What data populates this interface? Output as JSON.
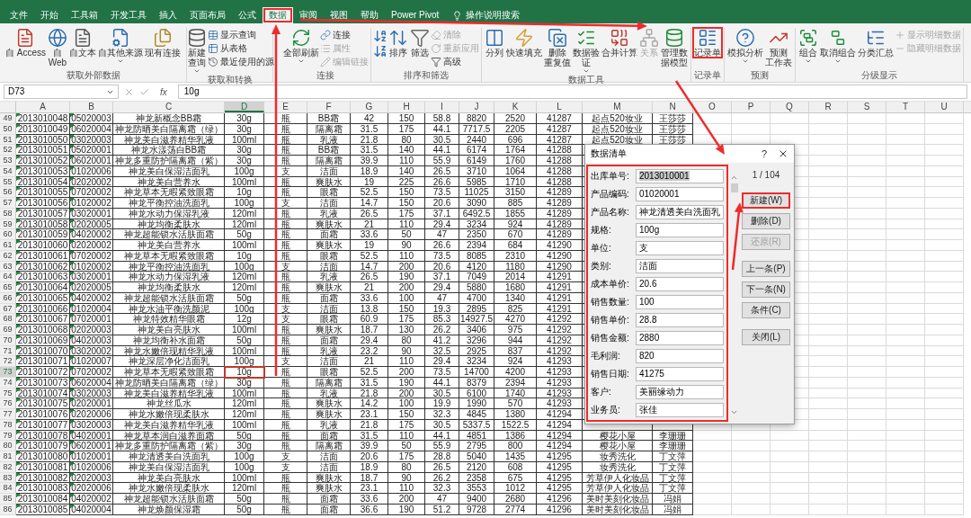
{
  "tabs": [
    {
      "label": "文件",
      "selected": false,
      "annotated": false
    },
    {
      "label": "开始",
      "selected": false,
      "annotated": false
    },
    {
      "label": "工具箱",
      "selected": false,
      "annotated": false
    },
    {
      "label": "开发工具",
      "selected": false,
      "annotated": false
    },
    {
      "label": "插入",
      "selected": false,
      "annotated": false
    },
    {
      "label": "页面布局",
      "selected": false,
      "annotated": false
    },
    {
      "label": "公式",
      "selected": false,
      "annotated": false
    },
    {
      "label": "数据",
      "selected": true,
      "annotated": true
    },
    {
      "label": "审阅",
      "selected": false,
      "annotated": false
    },
    {
      "label": "视图",
      "selected": false,
      "annotated": false
    },
    {
      "label": "帮助",
      "selected": false,
      "annotated": false
    },
    {
      "label": "Power Pivot",
      "selected": false,
      "annotated": false
    }
  ],
  "tell_me": "操作说明搜索",
  "ribbon": {
    "groups": [
      {
        "label": "获取外部数据",
        "items": [
          {
            "kind": "large",
            "lines": [
              "自 Access"
            ],
            "dropdown": false,
            "disabled": false,
            "annotated": false
          },
          {
            "kind": "large",
            "lines": [
              "自",
              "Web"
            ],
            "dropdown": false,
            "disabled": false,
            "annotated": false
          },
          {
            "kind": "large",
            "lines": [
              "自文本"
            ],
            "dropdown": false,
            "disabled": false,
            "annotated": false
          },
          {
            "kind": "large",
            "lines": [
              "自其他来源"
            ],
            "dropdown": true,
            "disabled": false,
            "annotated": false
          },
          {
            "kind": "large",
            "lines": [
              "现有连接"
            ],
            "dropdown": false,
            "disabled": false,
            "annotated": false
          }
        ]
      },
      {
        "label": "获取和转换",
        "items": [
          {
            "kind": "large",
            "lines": [
              "新建",
              "查询"
            ],
            "dropdown": true,
            "disabled": false,
            "annotated": false
          },
          {
            "kind": "stack",
            "items": [
              {
                "label": "显示查询",
                "disabled": false
              },
              {
                "label": "从表格",
                "disabled": false
              },
              {
                "label": "最近使用的源",
                "disabled": false
              }
            ]
          }
        ]
      },
      {
        "label": "连接",
        "items": [
          {
            "kind": "large",
            "lines": [
              "全部刷新"
            ],
            "dropdown": true,
            "disabled": false,
            "annotated": false
          },
          {
            "kind": "stack",
            "items": [
              {
                "label": "连接",
                "disabled": false
              },
              {
                "label": "属性",
                "disabled": true
              },
              {
                "label": "编辑链接",
                "disabled": true
              }
            ]
          }
        ]
      },
      {
        "label": "排序和筛选",
        "items": [
          {
            "kind": "sort-pair"
          },
          {
            "kind": "large",
            "lines": [
              "排序"
            ],
            "dropdown": false,
            "disabled": false,
            "annotated": false
          },
          {
            "kind": "large",
            "lines": [
              "筛选"
            ],
            "dropdown": false,
            "disabled": false,
            "annotated": false
          },
          {
            "kind": "stack",
            "items": [
              {
                "label": "清除",
                "disabled": true
              },
              {
                "label": "重新应用",
                "disabled": true
              },
              {
                "label": "高级",
                "disabled": false
              }
            ]
          }
        ]
      },
      {
        "label": "数据工具",
        "items": [
          {
            "kind": "large",
            "lines": [
              "分列"
            ],
            "dropdown": false,
            "disabled": false,
            "annotated": false
          },
          {
            "kind": "large",
            "lines": [
              "快速填充"
            ],
            "dropdown": false,
            "disabled": false,
            "annotated": false
          },
          {
            "kind": "large",
            "lines": [
              "删除",
              "重复值"
            ],
            "dropdown": false,
            "disabled": false,
            "annotated": false
          },
          {
            "kind": "large",
            "lines": [
              "数据验",
              "证"
            ],
            "dropdown": true,
            "disabled": false,
            "annotated": false
          },
          {
            "kind": "large",
            "lines": [
              "合并计算"
            ],
            "dropdown": false,
            "disabled": false,
            "annotated": false
          },
          {
            "kind": "large",
            "lines": [
              "关系"
            ],
            "dropdown": false,
            "disabled": true,
            "annotated": false
          },
          {
            "kind": "large",
            "lines": [
              "管理数",
              "据模型"
            ],
            "dropdown": false,
            "disabled": false,
            "annotated": false
          }
        ]
      },
      {
        "label": "记录单",
        "items": [
          {
            "kind": "large",
            "lines": [
              "记录单"
            ],
            "dropdown": false,
            "disabled": false,
            "annotated": true
          }
        ]
      },
      {
        "label": "预测",
        "items": [
          {
            "kind": "large",
            "lines": [
              "模拟分析"
            ],
            "dropdown": true,
            "disabled": false,
            "annotated": false
          },
          {
            "kind": "large",
            "lines": [
              "预测",
              "工作表"
            ],
            "dropdown": false,
            "disabled": false,
            "annotated": false
          }
        ]
      },
      {
        "label": "分级显示",
        "items": [
          {
            "kind": "large",
            "lines": [
              "组合"
            ],
            "dropdown": true,
            "disabled": false,
            "annotated": false
          },
          {
            "kind": "large",
            "lines": [
              "取消组合"
            ],
            "dropdown": true,
            "disabled": false,
            "annotated": false
          },
          {
            "kind": "large",
            "lines": [
              "分类汇总"
            ],
            "dropdown": false,
            "disabled": false,
            "annotated": false
          },
          {
            "kind": "stack",
            "items": [
              {
                "label": "显示明细数据",
                "disabled": true
              },
              {
                "label": "隐藏明细数据",
                "disabled": true
              }
            ]
          }
        ]
      }
    ]
  },
  "formula_bar": {
    "name_box": "D73",
    "fx": "fx",
    "value": "10g"
  },
  "sheet": {
    "columns": [
      {
        "label": "A",
        "selected": false,
        "flag": true
      },
      {
        "label": "B",
        "selected": false,
        "flag": true
      },
      {
        "label": "C",
        "selected": false,
        "flag": false
      },
      {
        "label": "D",
        "selected": true,
        "flag": false
      },
      {
        "label": "E",
        "selected": false,
        "flag": false
      },
      {
        "label": "F",
        "selected": false,
        "flag": false
      },
      {
        "label": "G",
        "selected": false,
        "flag": false
      },
      {
        "label": "H",
        "selected": false,
        "flag": false
      },
      {
        "label": "I",
        "selected": false,
        "flag": false
      },
      {
        "label": "J",
        "selected": false,
        "flag": false
      },
      {
        "label": "K",
        "selected": false,
        "flag": false
      },
      {
        "label": "L",
        "selected": false,
        "flag": false
      },
      {
        "label": "M",
        "selected": false,
        "flag": false
      },
      {
        "label": "N",
        "selected": false,
        "flag": false
      },
      {
        "label": "O",
        "selected": false,
        "flag": false
      },
      {
        "label": "P",
        "selected": false,
        "flag": false
      },
      {
        "label": "Q",
        "selected": false,
        "flag": false
      },
      {
        "label": "R",
        "selected": false,
        "flag": false
      },
      {
        "label": "S",
        "selected": false,
        "flag": false
      },
      {
        "label": "T",
        "selected": false,
        "flag": false
      },
      {
        "label": "U",
        "selected": false,
        "flag": false
      }
    ],
    "rows": [
      {
        "number": "49",
        "selected": false,
        "cells": [
          "2013010048",
          "05020003",
          "神龙新概念BB霜",
          "30g",
          "瓶",
          "BB霜",
          "42",
          "150",
          "58.8",
          "8820",
          "2520",
          "41287",
          "起点520妆业",
          "王莎莎"
        ]
      },
      {
        "number": "50",
        "selected": false,
        "cells": [
          "2013010049",
          "06020004",
          "神龙防晒美白隔离霜（绿）",
          "30g",
          "瓶",
          "隔离霜",
          "31.5",
          "175",
          "44.1",
          "7717.5",
          "2205",
          "41287",
          "起点520妆业",
          "王莎莎"
        ]
      },
      {
        "number": "51",
        "selected": false,
        "cells": [
          "2013010050",
          "03020003",
          "神龙美白滋养精华乳液",
          "100ml",
          "瓶",
          "乳液",
          "21.8",
          "80",
          "30.5",
          "2440",
          "696",
          "41287",
          "起点520妆业",
          "王莎莎"
        ]
      },
      {
        "number": "52",
        "selected": false,
        "cells": [
          "2013010051",
          "05020001",
          "神龙水漾荡白BB霜",
          "30g",
          "瓶",
          "BB霜",
          "31.5",
          "140",
          "44.1",
          "6174",
          "1764",
          "41288"
        ]
      },
      {
        "number": "53",
        "selected": false,
        "cells": [
          "2013010052",
          "06020001",
          "神龙多重防护隔离霜（紫）",
          "30g",
          "瓶",
          "隔离霜",
          "39.9",
          "110",
          "55.9",
          "6149",
          "1760",
          "41288"
        ]
      },
      {
        "number": "54",
        "selected": false,
        "cells": [
          "2013010053",
          "01020006",
          "神龙美白保湿洁面乳",
          "100g",
          "支",
          "洁面",
          "18.9",
          "140",
          "26.5",
          "3710",
          "1064",
          "41288"
        ]
      },
      {
        "number": "55",
        "selected": false,
        "cells": [
          "2013010054",
          "02020002",
          "神龙美白营养水",
          "100ml",
          "瓶",
          "爽肤水",
          "19",
          "225",
          "26.6",
          "5985",
          "1710",
          "41288"
        ]
      },
      {
        "number": "56",
        "selected": false,
        "cells": [
          "2013010055",
          "07020002",
          "神龙草本无暇紧致眼霜",
          "10g",
          "瓶",
          "眼霜",
          "52.5",
          "150",
          "73.5",
          "11025",
          "3150",
          "41289"
        ]
      },
      {
        "number": "57",
        "selected": false,
        "cells": [
          "2013010056",
          "01020002",
          "神龙平衡控油洗面乳",
          "100g",
          "支",
          "洁面",
          "14.7",
          "150",
          "20.6",
          "3090",
          "885",
          "41289"
        ]
      },
      {
        "number": "58",
        "selected": false,
        "cells": [
          "2013010057",
          "03020001",
          "神龙水动力保湿乳液",
          "120ml",
          "瓶",
          "乳液",
          "26.5",
          "175",
          "37.1",
          "6492.5",
          "1855",
          "41289"
        ]
      },
      {
        "number": "59",
        "selected": false,
        "cells": [
          "2013010058",
          "02020005",
          "神龙均衡柔肤水",
          "120ml",
          "瓶",
          "爽肤水",
          "21",
          "110",
          "29.4",
          "3234",
          "924",
          "41289"
        ]
      },
      {
        "number": "60",
        "selected": false,
        "cells": [
          "2013010059",
          "04020002",
          "神龙超能锁水活肤面霜",
          "50g",
          "瓶",
          "面霜",
          "33.6",
          "50",
          "47",
          "2350",
          "670",
          "41289"
        ]
      },
      {
        "number": "61",
        "selected": false,
        "cells": [
          "2013010060",
          "02020002",
          "神龙美白营养水",
          "100ml",
          "瓶",
          "爽肤水",
          "19",
          "90",
          "26.6",
          "2394",
          "684",
          "41290"
        ]
      },
      {
        "number": "62",
        "selected": false,
        "cells": [
          "2013010061",
          "07020002",
          "神龙草本无暇紧致眼霜",
          "10g",
          "瓶",
          "眼霜",
          "52.5",
          "110",
          "73.5",
          "8085",
          "2310",
          "41290"
        ]
      },
      {
        "number": "63",
        "selected": false,
        "cells": [
          "2013010062",
          "01020002",
          "神龙平衡控油洗面乳",
          "100g",
          "支",
          "洁面",
          "14.7",
          "200",
          "20.6",
          "4120",
          "1180",
          "41290"
        ]
      },
      {
        "number": "64",
        "selected": false,
        "cells": [
          "2013010063",
          "03020001",
          "神龙水动力保湿乳液",
          "120ml",
          "瓶",
          "乳液",
          "26.5",
          "190",
          "37.1",
          "7049",
          "2014",
          "41291"
        ]
      },
      {
        "number": "65",
        "selected": false,
        "cells": [
          "2013010064",
          "02020005",
          "神龙均衡柔肤水",
          "120ml",
          "瓶",
          "爽肤水",
          "21",
          "200",
          "29.4",
          "5880",
          "1680",
          "41291"
        ]
      },
      {
        "number": "66",
        "selected": false,
        "cells": [
          "2013010065",
          "04020002",
          "神龙超能锁水活肤面霜",
          "50g",
          "瓶",
          "面霜",
          "33.6",
          "100",
          "47",
          "4700",
          "1340",
          "41291"
        ]
      },
      {
        "number": "67",
        "selected": false,
        "cells": [
          "2013010066",
          "01020004",
          "神龙水油平衡洗颜泥",
          "100g",
          "支",
          "洁面",
          "13.8",
          "150",
          "19.3",
          "2895",
          "825",
          "41291"
        ]
      },
      {
        "number": "68",
        "selected": false,
        "cells": [
          "2013010067",
          "07020001",
          "神龙特效精华眼霜",
          "12g",
          "支",
          "眼霜",
          "60.9",
          "175",
          "85.3",
          "14927.5",
          "4270",
          "41292"
        ]
      },
      {
        "number": "69",
        "selected": false,
        "cells": [
          "2013010068",
          "02020003",
          "神龙美白亮肤水",
          "100ml",
          "瓶",
          "爽肤水",
          "18.7",
          "130",
          "26.2",
          "3406",
          "975",
          "41292"
        ]
      },
      {
        "number": "70",
        "selected": false,
        "cells": [
          "2013010069",
          "04020003",
          "神龙均衡补水面霜",
          "50g",
          "瓶",
          "面霜",
          "29.4",
          "80",
          "41.2",
          "3296",
          "944",
          "41292"
        ]
      },
      {
        "number": "71",
        "selected": false,
        "cells": [
          "2013010070",
          "03020002",
          "神龙水嫩倍现精华乳液",
          "100ml",
          "瓶",
          "乳液",
          "23.2",
          "90",
          "32.5",
          "2925",
          "837",
          "41292"
        ]
      },
      {
        "number": "72",
        "selected": false,
        "cells": [
          "2013010071",
          "01020007",
          "神龙深层净化洁面乳",
          "100g",
          "支",
          "洁面",
          "21",
          "110",
          "29.4",
          "3234",
          "924",
          "41293"
        ]
      },
      {
        "number": "73",
        "selected": true,
        "cells": [
          "2013010072",
          "07020002",
          "神龙草本无暇紧致眼霜",
          "10g",
          "瓶",
          "眼霜",
          "52.5",
          "200",
          "73.5",
          "14700",
          "4200",
          "41293"
        ]
      },
      {
        "number": "74",
        "selected": false,
        "cells": [
          "2013010073",
          "06020004",
          "神龙防晒美白隔离霜（绿）",
          "30g",
          "瓶",
          "隔离霜",
          "31.5",
          "190",
          "44.1",
          "8379",
          "2394",
          "41293"
        ]
      },
      {
        "number": "75",
        "selected": false,
        "cells": [
          "2013010074",
          "03020003",
          "神龙美白滋养精华乳液",
          "100ml",
          "瓶",
          "乳液",
          "21.8",
          "200",
          "30.5",
          "6100",
          "1740",
          "41293"
        ]
      },
      {
        "number": "76",
        "selected": false,
        "cells": [
          "2013010075",
          "02020001",
          "神龙丝瓜水",
          "120ml",
          "瓶",
          "爽肤水",
          "14.2",
          "100",
          "19.9",
          "1990",
          "570",
          "41293"
        ]
      },
      {
        "number": "77",
        "selected": false,
        "cells": [
          "2013010076",
          "02020006",
          "神龙水嫩倍现柔肤水",
          "120ml",
          "瓶",
          "爽肤水",
          "23.1",
          "150",
          "32.3",
          "4845",
          "1380",
          "41294"
        ]
      },
      {
        "number": "78",
        "selected": false,
        "cells": [
          "2013010077",
          "03020003",
          "神龙美白滋养精华乳液",
          "100ml",
          "瓶",
          "乳液",
          "21.8",
          "175",
          "30.5",
          "5337.5",
          "1522.5",
          "41294"
        ]
      },
      {
        "number": "79",
        "selected": false,
        "cells": [
          "2013010078",
          "04020001",
          "神龙草本润白滋养面霜",
          "50g",
          "瓶",
          "面霜",
          "31.5",
          "110",
          "44.1",
          "4851",
          "1386",
          "41294",
          "樱花小屋",
          "李珊珊"
        ]
      },
      {
        "number": "80",
        "selected": false,
        "cells": [
          "2013010079",
          "06020001",
          "神龙多重防护隔离霜（紫）",
          "30g",
          "瓶",
          "隔离霜",
          "39.9",
          "50",
          "55.9",
          "2795",
          "800",
          "41294",
          "樱花小屋",
          "李珊珊"
        ]
      },
      {
        "number": "81",
        "selected": false,
        "cells": [
          "2013010080",
          "01020001",
          "神龙清透美白洗面乳",
          "100g",
          "支",
          "洁面",
          "20.6",
          "175",
          "28.8",
          "5040",
          "1435",
          "41295",
          "妆秀洗化",
          "丁文萍"
        ]
      },
      {
        "number": "82",
        "selected": false,
        "cells": [
          "2013010081",
          "01020006",
          "神龙美白保湿洁面乳",
          "100g",
          "支",
          "洁面",
          "18.9",
          "80",
          "26.5",
          "2120",
          "608",
          "41295",
          "妆秀洗化",
          "丁文萍"
        ]
      },
      {
        "number": "83",
        "selected": false,
        "cells": [
          "2013010082",
          "02020003",
          "神龙美白亮肤水",
          "100ml",
          "瓶",
          "爽肤水",
          "18.7",
          "90",
          "26.2",
          "2358",
          "675",
          "41295",
          "芳草伊人化妆品",
          "丁文萍"
        ]
      },
      {
        "number": "84",
        "selected": false,
        "cells": [
          "2013010083",
          "02020006",
          "神龙水嫩倍现柔肤水",
          "120ml",
          "瓶",
          "爽肤水",
          "23.1",
          "110",
          "32.3",
          "3553",
          "1012",
          "41295",
          "芳草伊人化妆品",
          "丁文萍"
        ]
      },
      {
        "number": "85",
        "selected": false,
        "cells": [
          "2013010084",
          "04020002",
          "神龙超能锁水活肤面霜",
          "50g",
          "瓶",
          "面霜",
          "33.6",
          "200",
          "47",
          "9400",
          "2680",
          "41296",
          "美时美刻化妆品",
          "冯娟"
        ]
      },
      {
        "number": "86",
        "selected": false,
        "cells": [
          "2013010085",
          "04020004",
          "神龙焕颜保湿霜",
          "50g",
          "瓶",
          "面霜",
          "36.6",
          "190",
          "51.2",
          "9728",
          "2774",
          "41296",
          "美时美刻化妆品",
          "冯娟"
        ]
      }
    ]
  },
  "dialog": {
    "title": "数据清单",
    "help": "?",
    "annotated": true,
    "counter": "1 / 104",
    "fields": [
      {
        "label": "出库单号:",
        "value": "2013010001",
        "selected": true
      },
      {
        "label": "产品编码:",
        "value": "01020001",
        "selected": false
      },
      {
        "label": "产品名称:",
        "value": "神龙清透美白洗面乳",
        "selected": false
      },
      {
        "label": "规格:",
        "value": "100g",
        "selected": false
      },
      {
        "label": "单位:",
        "value": "支",
        "selected": false
      },
      {
        "label": "类别:",
        "value": "洁面",
        "selected": false
      },
      {
        "label": "成本单价:",
        "value": "20.6",
        "selected": false
      },
      {
        "label": "销售数量:",
        "value": "100",
        "selected": false
      },
      {
        "label": "销售单价:",
        "value": "28.8",
        "selected": false
      },
      {
        "label": "销售金额:",
        "value": "2880",
        "selected": false
      },
      {
        "label": "毛利润:",
        "value": "820",
        "selected": false
      },
      {
        "label": "销售日期:",
        "value": "41275",
        "selected": false
      },
      {
        "label": "客户:",
        "value": "美丽缘动力",
        "selected": false
      },
      {
        "label": "业务员:",
        "value": "张佳",
        "selected": false
      }
    ],
    "button_groups": [
      [
        {
          "label": "新建(W)",
          "disabled": false,
          "annotated": true
        },
        {
          "label": "删除(D)",
          "disabled": false,
          "annotated": false
        },
        {
          "label": "还原(R)",
          "disabled": true,
          "annotated": false
        }
      ],
      [
        {
          "label": "上一条(P)",
          "disabled": false,
          "annotated": false
        },
        {
          "label": "下一条(N)",
          "disabled": false,
          "annotated": false
        },
        {
          "label": "条件(C)",
          "disabled": false,
          "annotated": false
        }
      ],
      [
        {
          "label": "关闭(L)",
          "disabled": false,
          "annotated": false
        }
      ]
    ]
  }
}
